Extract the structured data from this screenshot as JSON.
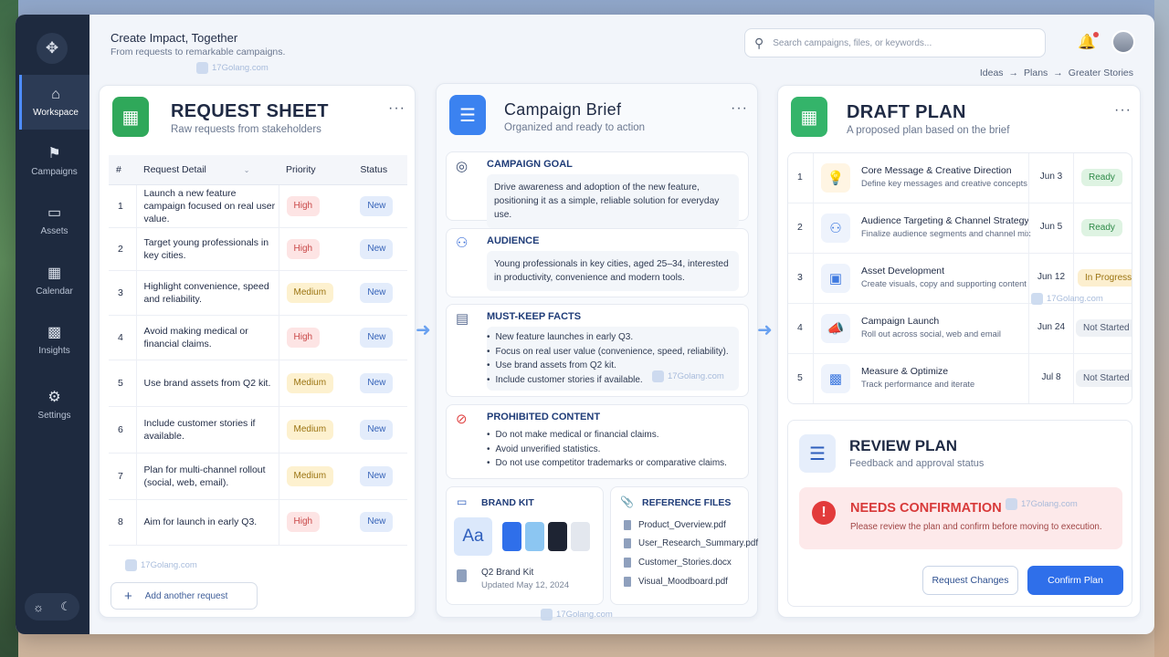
{
  "header": {
    "title": "Create Impact, Together",
    "subtitle": "From requests to remarkable campaigns.",
    "search_placeholder": "Search campaigns, files, or keywords...",
    "breadcrumb": [
      "Ideas",
      "Plans",
      "Greater Stories"
    ],
    "breadcrumb_sep": "→"
  },
  "watermark": "17Golang.com",
  "sidebar": {
    "items": [
      {
        "label": "Workspace",
        "icon": "home-icon",
        "active": true
      },
      {
        "label": "Campaigns",
        "icon": "megaphone-icon",
        "active": false
      },
      {
        "label": "Assets",
        "icon": "folder-icon",
        "active": false
      },
      {
        "label": "Calendar",
        "icon": "calendar-icon",
        "active": false
      },
      {
        "label": "Insights",
        "icon": "bar-chart-icon",
        "active": false
      },
      {
        "label": "Settings",
        "icon": "gear-icon",
        "active": false
      }
    ]
  },
  "request_sheet": {
    "title": "REQUEST SHEET",
    "subtitle": "Raw requests from stakeholders",
    "columns": [
      "#",
      "Request Detail",
      "Priority",
      "Status"
    ],
    "rows": [
      {
        "num": "1",
        "detail": "Launch a new feature campaign focused on real user value.",
        "priority": "High",
        "status": "New"
      },
      {
        "num": "2",
        "detail": "Target young professionals in key cities.",
        "priority": "High",
        "status": "New"
      },
      {
        "num": "3",
        "detail": "Highlight convenience, speed and reliability.",
        "priority": "Medium",
        "status": "New"
      },
      {
        "num": "4",
        "detail": "Avoid making medical or financial claims.",
        "priority": "High",
        "status": "New"
      },
      {
        "num": "5",
        "detail": "Use brand assets from Q2 kit.",
        "priority": "Medium",
        "status": "New"
      },
      {
        "num": "6",
        "detail": "Include customer stories if available.",
        "priority": "Medium",
        "status": "New"
      },
      {
        "num": "7",
        "detail": "Plan for multi-channel rollout (social, web, email).",
        "priority": "Medium",
        "status": "New"
      },
      {
        "num": "8",
        "detail": "Aim for launch in early Q3.",
        "priority": "High",
        "status": "New"
      }
    ],
    "add_label": "Add another request"
  },
  "brief": {
    "title": "Campaign Brief",
    "subtitle": "Organized and ready to action",
    "goal": {
      "heading": "CAMPAIGN GOAL",
      "text": "Drive awareness and adoption of the new feature, positioning it as a simple, reliable solution for everyday use."
    },
    "audience": {
      "heading": "AUDIENCE",
      "text": "Young professionals in key cities, aged 25–34, interested in productivity, convenience and modern tools."
    },
    "facts": {
      "heading": "MUST-KEEP FACTS",
      "items": [
        "New feature launches in early Q3.",
        "Focus on real user value (convenience, speed, reliability).",
        "Use brand assets from Q2 kit.",
        "Include customer stories if available."
      ]
    },
    "prohibited": {
      "heading": "PROHIBITED CONTENT",
      "items": [
        "Do not make medical or financial claims.",
        "Avoid unverified statistics.",
        "Do not use competitor trademarks or comparative claims."
      ]
    },
    "brand_kit": {
      "heading": "BRAND KIT",
      "sample": "Aa",
      "name": "Q2 Brand Kit",
      "updated": "Updated May 12, 2024",
      "colors": [
        "#2f6fea",
        "#8cc6f2",
        "#1e2433",
        "#e3e7ee"
      ]
    },
    "reference": {
      "heading": "REFERENCE FILES",
      "files": [
        "Product_Overview.pdf",
        "User_Research_Summary.pdf",
        "Customer_Stories.docx",
        "Visual_Moodboard.pdf"
      ]
    }
  },
  "draft": {
    "title": "DRAFT PLAN",
    "subtitle": "A proposed plan based on the brief",
    "rows": [
      {
        "num": "1",
        "title": "Core Message & Creative Direction",
        "desc": "Define key messages and creative concepts",
        "date": "Jun 3",
        "status": "Ready",
        "icon": "lightbulb-icon"
      },
      {
        "num": "2",
        "title": "Audience Targeting & Channel Strategy",
        "desc": "Finalize audience segments and channel mix",
        "date": "Jun 5",
        "status": "Ready",
        "icon": "users-icon"
      },
      {
        "num": "3",
        "title": "Asset Development",
        "desc": "Create visuals, copy and supporting content",
        "date": "Jun 12",
        "status": "In Progress",
        "icon": "image-icon"
      },
      {
        "num": "4",
        "title": "Campaign Launch",
        "desc": "Roll out across social, web and email",
        "date": "Jun 24",
        "status": "Not Started",
        "icon": "megaphone-icon"
      },
      {
        "num": "5",
        "title": "Measure & Optimize",
        "desc": "Track performance and iterate",
        "date": "Jul 8",
        "status": "Not Started",
        "icon": "bar-chart-icon"
      }
    ]
  },
  "review": {
    "title": "REVIEW PLAN",
    "subtitle": "Feedback and approval status",
    "alert_title": "NEEDS CONFIRMATION",
    "alert_text": "Please review the plan and confirm before moving to execution.",
    "request_changes": "Request Changes",
    "confirm": "Confirm Plan"
  }
}
